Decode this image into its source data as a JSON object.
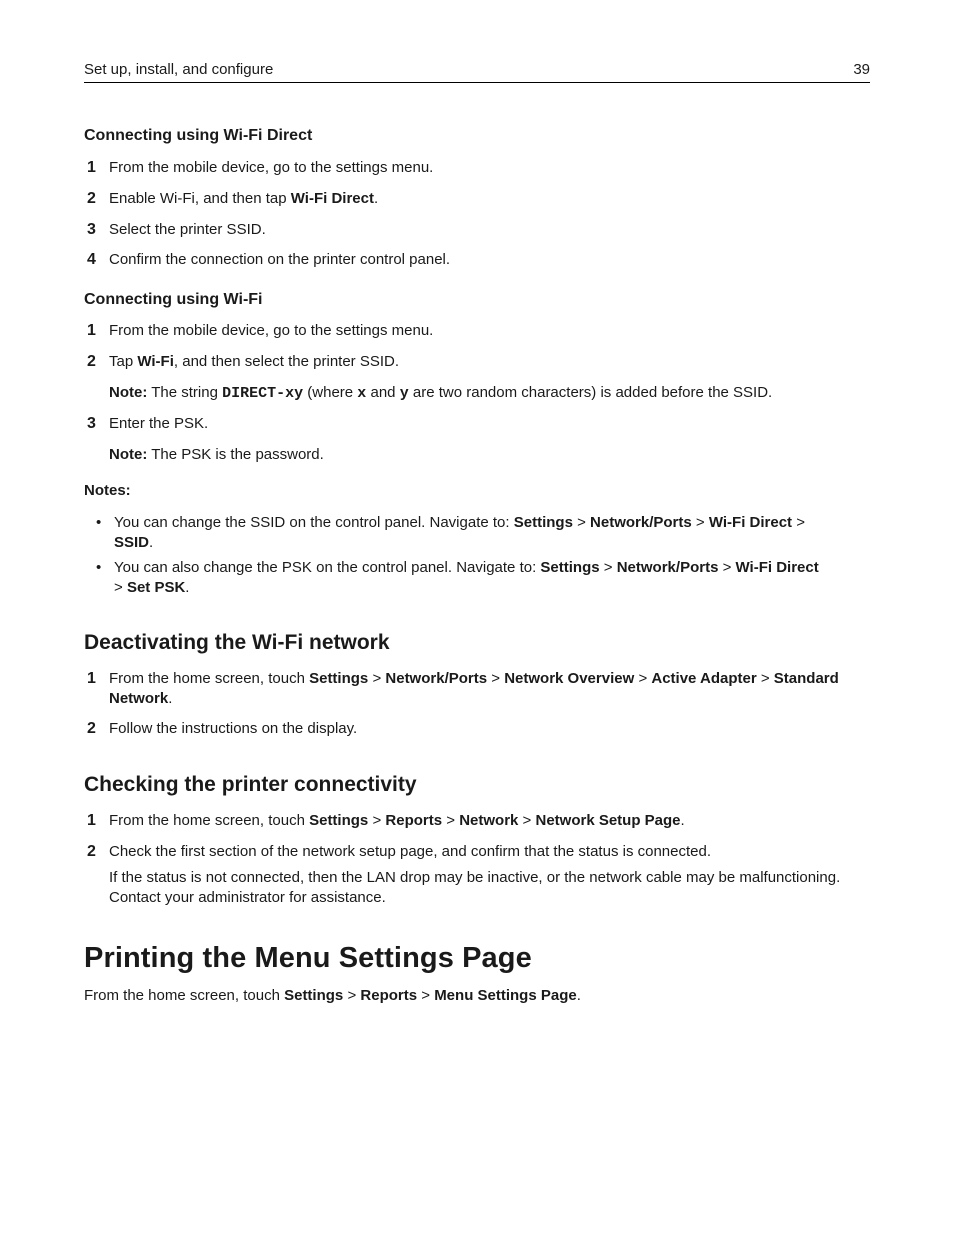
{
  "header": {
    "section_title": "Set up, install, and configure",
    "page_number": "39"
  },
  "wifi_direct": {
    "heading": "Connecting using Wi-Fi Direct",
    "steps": [
      {
        "num": "1",
        "text": "From the mobile device, go to the settings menu."
      },
      {
        "num": "2",
        "pre": "Enable Wi-Fi, and then tap ",
        "bold": "Wi-Fi Direct",
        "post": "."
      },
      {
        "num": "3",
        "text": "Select the printer SSID."
      },
      {
        "num": "4",
        "text": "Confirm the connection on the printer control panel."
      }
    ]
  },
  "wifi": {
    "heading": "Connecting using Wi-Fi",
    "steps": [
      {
        "num": "1",
        "text": "From the mobile device, go to the settings menu."
      },
      {
        "num": "2",
        "pre": "Tap ",
        "bold": "Wi-Fi",
        "post": ", and then select the printer SSID."
      },
      {
        "num": "3",
        "text": "Enter the PSK."
      }
    ],
    "note1": {
      "label": "Note:",
      "pre": " The string ",
      "code1": "DIRECT-xy",
      "mid1": " (where ",
      "code2": "x",
      "mid2": " and ",
      "code3": "y",
      "post": " are two random characters) is added before the SSID."
    },
    "note2": {
      "label": "Note:",
      "text": " The PSK is the password."
    }
  },
  "notes": {
    "label": "Notes:",
    "bullets": [
      {
        "text": "You can change the SSID on the control panel. Navigate to: ",
        "path": [
          "Settings",
          "Network/Ports",
          "Wi-Fi Direct",
          "SSID"
        ]
      },
      {
        "text": "You can also change the PSK on the control panel. Navigate to: ",
        "path": [
          "Settings",
          "Network/Ports",
          "Wi-Fi Direct",
          "Set PSK"
        ]
      }
    ],
    "separator": ">"
  },
  "deactivate": {
    "heading": "Deactivating the Wi-Fi network",
    "step1": {
      "num": "1",
      "pre": "From the home screen, touch ",
      "path": [
        "Settings",
        "Network/Ports",
        "Network Overview",
        "Active Adapter",
        "Standard Network"
      ]
    },
    "step2": {
      "num": "2",
      "text": "Follow the instructions on the display."
    }
  },
  "connectivity": {
    "heading": "Checking the printer connectivity",
    "step1": {
      "num": "1",
      "pre": "From the home screen, touch ",
      "path": [
        "Settings",
        "Reports",
        "Network",
        "Network Setup Page"
      ]
    },
    "step2": {
      "num": "2",
      "text": "Check the first section of the network setup page, and confirm that the status is connected."
    },
    "followup": "If the status is not connected, then the LAN drop may be inactive, or the network cable may be malfunctioning. Contact your administrator for assistance."
  },
  "menu_settings": {
    "heading": "Printing the Menu Settings Page",
    "pre": "From the home screen, touch ",
    "path": [
      "Settings",
      "Reports",
      "Menu Settings Page"
    ]
  }
}
